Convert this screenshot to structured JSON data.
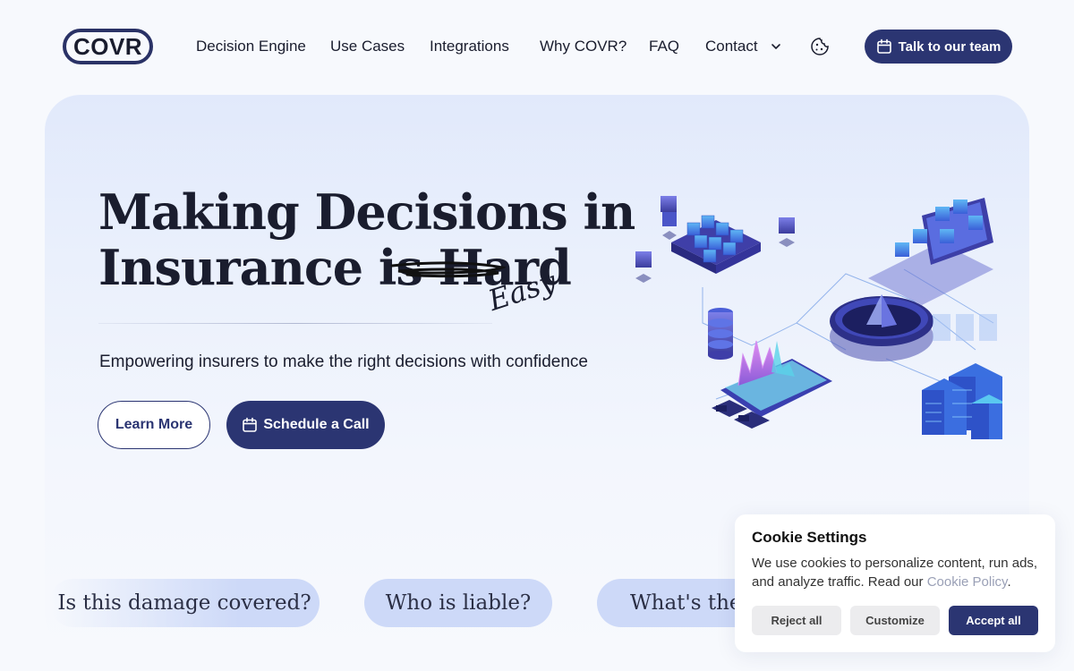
{
  "header": {
    "logo": "COVR",
    "nav": [
      {
        "label": "Decision Engine"
      },
      {
        "label": "Use Cases"
      },
      {
        "label": "Integrations"
      },
      {
        "label": "Why COVR?"
      },
      {
        "label": "FAQ"
      },
      {
        "label": "Contact"
      }
    ],
    "cta_label": "Talk to our team"
  },
  "hero": {
    "headline_line1": "Making Decisions in",
    "headline_line2": "Insurance is Hard",
    "handwritten": "Easy",
    "subhead": "Empowering insurers to make the right decisions with confidence",
    "learn_more": "Learn More",
    "schedule": "Schedule a Call"
  },
  "questions": [
    "Is this damage covered?",
    "Who is liable?",
    "What's the"
  ],
  "cookie": {
    "title": "Cookie Settings",
    "text": "We use cookies to personalize content, run ads, and analyze traffic. Read our ",
    "link": "Cookie Policy",
    "link_suffix": ".",
    "reject": "Reject all",
    "customize": "Customize",
    "accept": "Accept all"
  },
  "colors": {
    "brand": "#2b3572",
    "pill": "#cdd9f8",
    "hero_bg": "#e1e9fb"
  },
  "icons": [
    "chevron-down-icon",
    "cookie-icon",
    "calendar-icon"
  ]
}
